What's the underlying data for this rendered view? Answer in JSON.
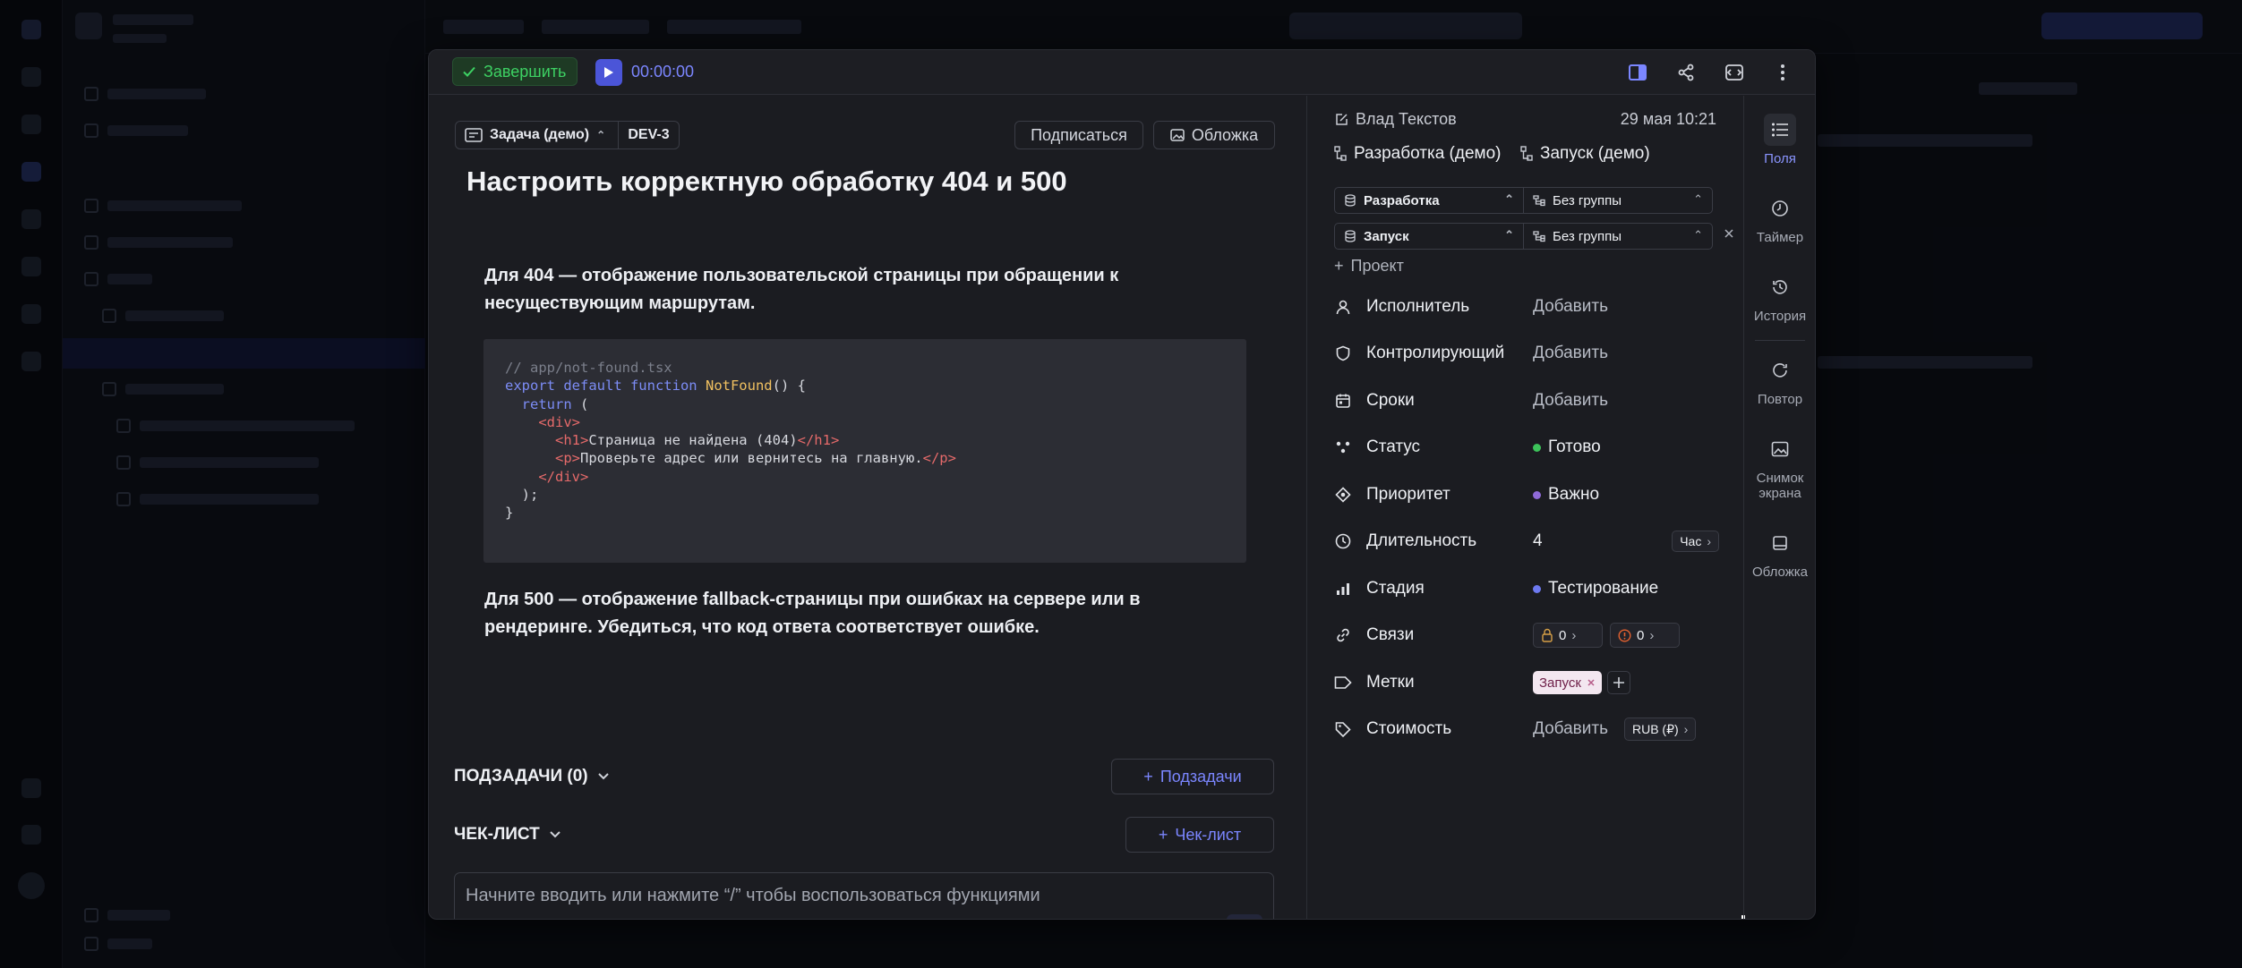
{
  "header": {
    "finish_label": "Завершить",
    "timer": "00:00:00"
  },
  "task": {
    "type_label": "Задача (демо)",
    "id": "DEV-3",
    "subscribe_label": "Подписаться",
    "cover_label": "Обложка",
    "title": "Настроить корректную обработку 404 и 500",
    "para1": "Для 404 — отображение пользовательской страницы при обращении к несуществующим маршрутам.",
    "para2": "Для 500 — отображение fallback-страницы при ошибках на сервере или в рендеринге. Убедиться, что код ответа соответствует ошибке.",
    "code": {
      "comment": "// app/not-found.tsx",
      "kw_export": "export default function",
      "fn_name": "NotFound",
      "after_fn": "() {",
      "kw_return": "return",
      "after_return": " (",
      "div_open": "<div>",
      "h1_open": "<h1>",
      "h1_text": "Страница не найдена (404)",
      "h1_close": "</h1>",
      "p_open": "<p>",
      "p_text": "Проверьте адрес или вернитесь на главную.",
      "p_close": "</p>",
      "div_close": "</div>",
      "paren_close": ");",
      "brace_close": "}"
    },
    "subtasks_label": "ПОДЗАДАЧИ (0)",
    "subtasks_add": "Подзадачи",
    "checklist_label": "ЧЕК-ЛИСТ",
    "checklist_add": "Чек-лист",
    "comment_placeholder": "Начните вводить или нажмите “/” чтобы воспользоваться функциями"
  },
  "details": {
    "author": "Влад Текстов",
    "date": "29 мая 10:21",
    "project1": "Разработка (демо)",
    "project2": "Запуск (демо)",
    "sel1_left": "Разработка",
    "sel1_right": "Без группы",
    "sel2_left": "Запуск",
    "sel2_right": "Без группы",
    "add_project": "Проект",
    "props": [
      {
        "label": "Исполнитель",
        "value": "Добавить"
      },
      {
        "label": "Контролирующий",
        "value": "Добавить"
      },
      {
        "label": "Сроки",
        "value": "Добавить"
      },
      {
        "label": "Статус",
        "value": "Готово",
        "color": "#3cc35a"
      },
      {
        "label": "Приоритет",
        "value": "Важно",
        "color": "#8f6ad8"
      },
      {
        "label": "Длительность",
        "value": "4",
        "unit": "Час"
      },
      {
        "label": "Стадия",
        "value": "Тестирование",
        "color": "#6d79f0"
      },
      {
        "label": "Связи",
        "lock_count": "0",
        "alert_count": "0"
      },
      {
        "label": "Метки",
        "tag": "Запуск"
      },
      {
        "label": "Стоимость",
        "value": "Добавить",
        "currency": "RUB (₽)"
      }
    ]
  },
  "rail": {
    "fields": "Поля",
    "timer": "Таймер",
    "history": "История",
    "repeat": "Повтор",
    "screenshot": "Снимок экрана",
    "cover": "Обложка"
  }
}
